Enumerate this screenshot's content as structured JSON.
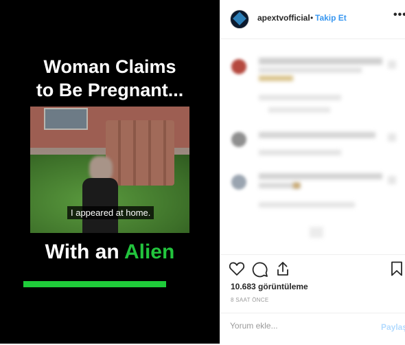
{
  "media": {
    "headline_line1": "Woman Claims",
    "headline_line2": "to Be Pregnant...",
    "caption": "I appeared at home.",
    "bottom_prefix": "With an ",
    "bottom_highlight": "Alien",
    "highlight_color": "#22c43d"
  },
  "post": {
    "username": "apextvofficial",
    "separator": "•",
    "follow_label": "Takip Et",
    "more_icon": "more-horizontal-icon"
  },
  "stats": {
    "views": "10.683 görüntüleme",
    "time": "8 SAAT ÖNCE"
  },
  "comment": {
    "placeholder": "Yorum ekle...",
    "post_label": "Paylaş"
  },
  "icons": [
    "heart-icon",
    "comment-icon",
    "share-icon",
    "bookmark-icon"
  ]
}
